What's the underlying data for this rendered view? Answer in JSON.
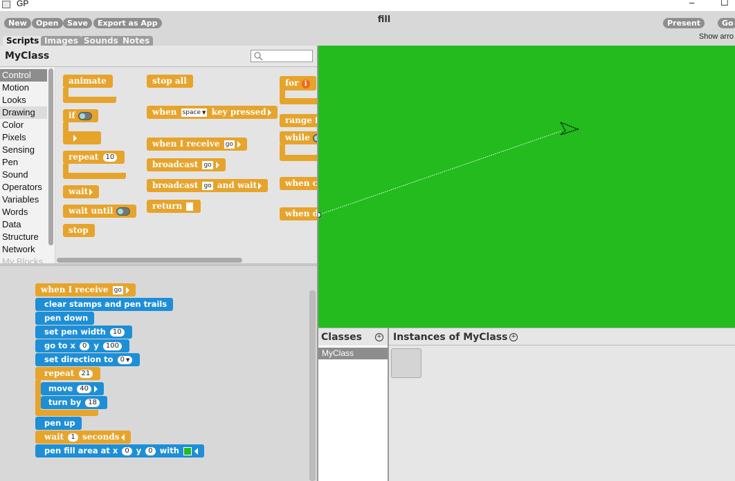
{
  "window": {
    "title": "GP"
  },
  "toolbar": {
    "buttons": [
      "New",
      "Open",
      "Save",
      "Export as App"
    ],
    "project_title": "fill",
    "present_label": "Present",
    "go_label": "Go",
    "show_arrows_label": "Show arro"
  },
  "tabs": [
    "Scripts",
    "Images",
    "Sounds",
    "Notes"
  ],
  "palette": {
    "class_name": "MyClass",
    "categories": [
      "Control",
      "Motion",
      "Looks",
      "Drawing",
      "Color",
      "Pixels",
      "Sensing",
      "Pen",
      "Sound",
      "Operators",
      "Variables",
      "Words",
      "Data",
      "Structure",
      "Network",
      "My Blocks"
    ],
    "selected_category": "Control",
    "blocks": {
      "animate": "animate",
      "if": "if",
      "repeat": "repeat",
      "repeat_n": "10",
      "wait": "wait",
      "wait_until": "wait until",
      "stop": "stop",
      "stop_all": "stop all",
      "when": "when",
      "key": "space",
      "key_pressed": "key pressed",
      "when_receive": "when I receive",
      "msg": "go",
      "broadcast": "broadcast",
      "and_wait": "and wait",
      "return": "return",
      "for": "for",
      "for_var": "i",
      "range": "range f",
      "while": "while",
      "when_cli": "when cli",
      "when_d": "when d"
    }
  },
  "script": {
    "when_receive": "when I receive",
    "msg": "go",
    "clear": "clear stamps and pen trails",
    "pen_down": "pen down",
    "set_pen_width": "set pen width",
    "pen_width": "10",
    "go_to_x": "go to x",
    "x": "0",
    "y_label": "y",
    "y": "100",
    "set_direction": "set direction to",
    "direction": "0",
    "repeat": "repeat",
    "repeat_n": "21",
    "move": "move",
    "move_n": "40",
    "turn_by": "turn by",
    "turn_n": "18",
    "pen_up": "pen up",
    "wait": "wait",
    "wait_n": "1",
    "seconds": "seconds",
    "pen_fill": "pen fill area at x",
    "fill_x": "0",
    "fill_y": "0",
    "with": "with",
    "fill_color": "#23bb1e"
  },
  "stage": {
    "background": "#23bb1e"
  },
  "classes": {
    "title": "Classes",
    "items": [
      "MyClass"
    ]
  },
  "instances": {
    "title": "Instances of MyClass"
  },
  "colors": {
    "control": "#e6a42c",
    "motion": "#1e8fd6",
    "accent": "#f06a1a"
  }
}
